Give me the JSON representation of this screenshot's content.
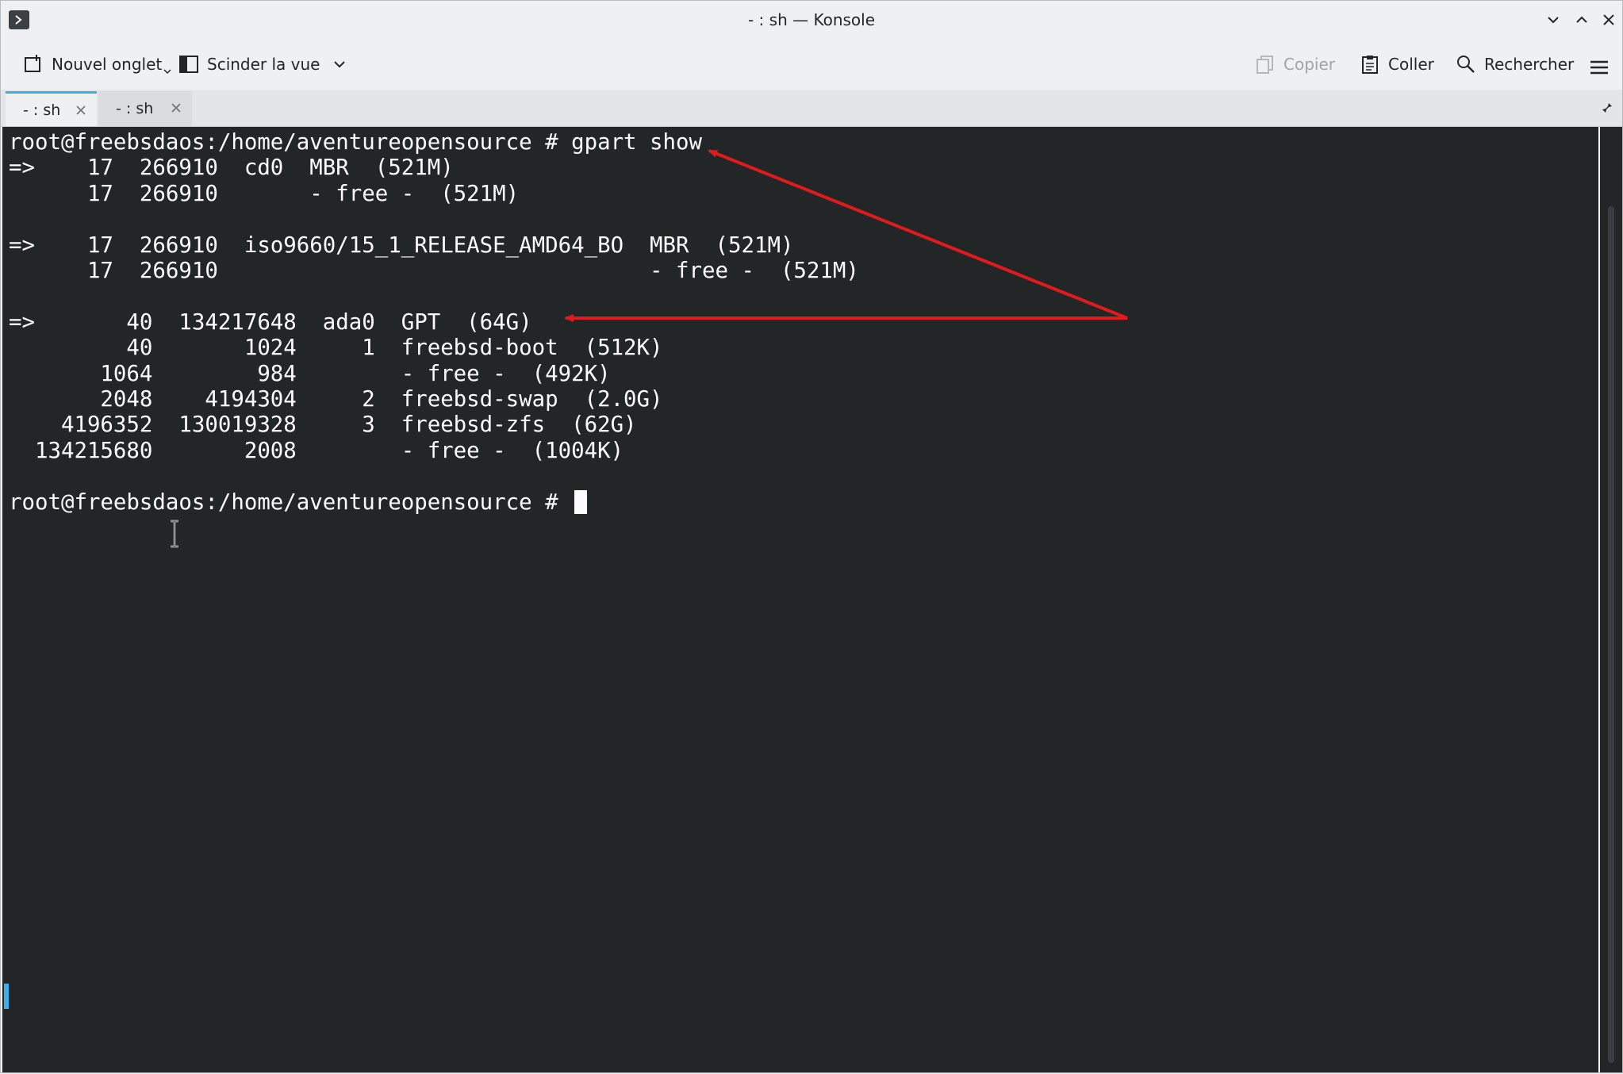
{
  "window": {
    "title": "- : sh — Konsole"
  },
  "toolbar": {
    "new_tab": "Nouvel onglet",
    "split_view": "Scinder la vue",
    "copy": "Copier",
    "paste": "Coller",
    "search": "Rechercher"
  },
  "tabs": [
    {
      "label": "- : sh",
      "active": true
    },
    {
      "label": "- : sh",
      "active": false
    }
  ],
  "terminal": {
    "lines": [
      "root@freebsdaos:/home/aventureopensource # gpart show",
      "=>    17  266910  cd0  MBR  (521M)",
      "      17  266910       - free -  (521M)",
      "",
      "=>    17  266910  iso9660/15_1_RELEASE_AMD64_BO  MBR  (521M)",
      "      17  266910                                 - free -  (521M)",
      "",
      "=>       40  134217648  ada0  GPT  (64G)",
      "         40       1024     1  freebsd-boot  (512K)",
      "       1064        984        - free -  (492K)",
      "       2048    4194304     2  freebsd-swap  (2.0G)",
      "    4196352  130019328     3  freebsd-zfs  (62G)",
      "  134215680       2008        - free -  (1004K)",
      ""
    ],
    "prompt": "root@freebsdaos:/home/aventureopensource # "
  },
  "colors": {
    "terminal_bg": "#232627",
    "terminal_fg": "#fcfcfc",
    "accent": "#3daee9",
    "annotation_arrow": "#e01b1b"
  }
}
